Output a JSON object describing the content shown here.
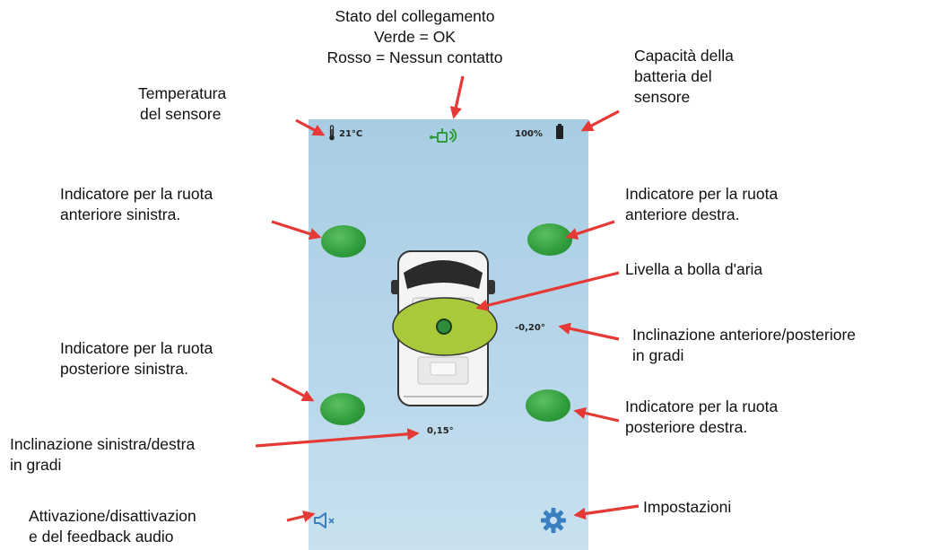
{
  "screen": {
    "temperature": "21°C",
    "battery": "100%",
    "front_rear_angle": "-0,20°",
    "left_right_angle": "0,15°"
  },
  "annotations": {
    "connection_status": {
      "line1": "Stato del collegamento",
      "line2": "Verde = OK",
      "line3": "Rosso = Nessun contatto"
    },
    "sensor_temperature": {
      "line1": "Temperatura",
      "line2": "del sensore"
    },
    "battery_capacity": {
      "line1": "Capacità della",
      "line2": "batteria del",
      "line3": "sensore"
    },
    "front_left": {
      "line1": "Indicatore per la ruota",
      "line2": "anteriore sinistra."
    },
    "front_right": {
      "line1": "Indicatore per la ruota",
      "line2": "anteriore destra."
    },
    "bubble_level": {
      "line1": "Livella a bolla d'aria"
    },
    "front_rear_tilt": {
      "line1": "Inclinazione anteriore/posteriore",
      "line2": "in gradi"
    },
    "rear_left": {
      "line1": "Indicatore per la ruota",
      "line2": "posteriore sinistra."
    },
    "rear_right": {
      "line1": "Indicatore per la ruota",
      "line2": "posteriore destra."
    },
    "left_right_tilt": {
      "line1": "Inclinazione sinistra/destra",
      "line2": "in gradi"
    },
    "audio_toggle": {
      "line1": "Attivazione/disattivazion",
      "line2": "e del feedback audio"
    },
    "settings": {
      "line1": "Impostazioni"
    }
  },
  "colors": {
    "arrow": "#e53935",
    "wheel_ok": "#2f9b3c",
    "bubble": "#a8c93a",
    "screen_bg": "#b7d6ea",
    "icon_blue": "#3a7fc0"
  },
  "icons": [
    "thermometer-icon",
    "connection-icon",
    "battery-icon",
    "speaker-muted-icon",
    "gear-icon"
  ]
}
